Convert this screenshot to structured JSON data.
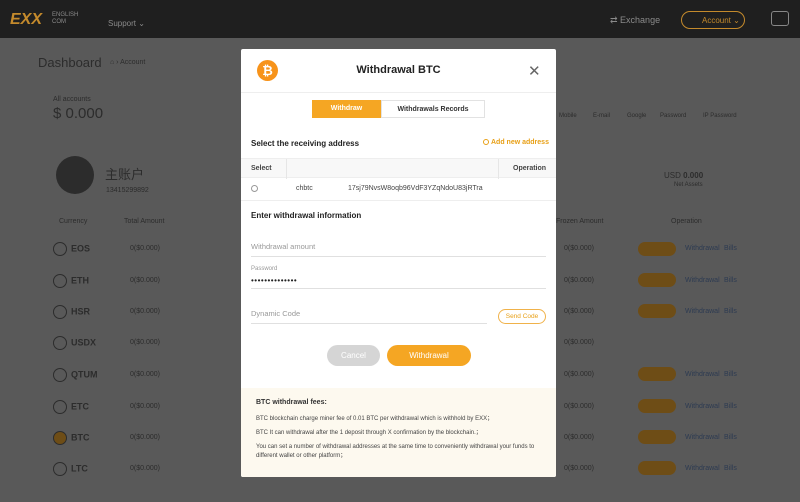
{
  "topbar": {
    "logo": "EXX",
    "logo_sub_1": "ENGLISH",
    "logo_sub_2": "COM",
    "support": "Support",
    "exchange": "Exchange",
    "account": "Account"
  },
  "background": {
    "page_title": "Dashboard",
    "breadcrumb": "Account",
    "all_accounts_label": "All accounts",
    "total": "$ 0.000",
    "account_name": "主账户",
    "account_id": "13415299892",
    "usd_label": "USD",
    "usd_value": "0.000",
    "net_assets": "Net Assets",
    "security_items": [
      "Mobile",
      "E-mail",
      "Google",
      "Password",
      "IP Password"
    ],
    "columns": [
      "Currency",
      "Total Amount",
      "Frozen Amount",
      "Operation"
    ],
    "coins": [
      "EOS",
      "ETH",
      "HSR",
      "USDX",
      "QTUM",
      "ETC",
      "BTC",
      "LTC"
    ],
    "zero_value": "0($0.000)",
    "withdrawal_link": "Withdrawal",
    "bills_link": "Bills"
  },
  "modal": {
    "title": "Withdrawal  BTC",
    "coin_symbol": "₿",
    "tabs": [
      {
        "label": "Withdraw",
        "active": true
      },
      {
        "label": "Withdrawals Records",
        "active": false
      }
    ],
    "receiving_title": "Select the receiving address",
    "add_address": "Add new address",
    "table_headers": [
      "Select",
      "Operation"
    ],
    "address_row": {
      "label": "chbtc",
      "address": "17sj79NvsW8oqb96VdF3YZqNdoU83jRTra"
    },
    "info_title": "Enter withdrawal information",
    "amount_placeholder": "Withdrawal amount",
    "password_label": "Password",
    "password_value": "••••••••••••••",
    "dynamic_code_placeholder": "Dynamic Code",
    "send_code": "Send Code",
    "cancel": "Cancel",
    "withdrawal": "Withdrawal",
    "fees_title": "BTC withdrawal fees:",
    "fees_lines": [
      "BTC blockchain charge miner fee of 0.01 BTC per withdrawal which is withhold by EXX；",
      "BTC It can withdrawal after the 1 deposit through X confirmation by the blockchain.；",
      "You can set a number of withdrawal addresses at the same time to conveniently withdrawal your funds to different wallet or other platform；"
    ]
  },
  "colors": {
    "accent": "#f5a623",
    "overlay": "#595959",
    "topbar": "#1f1f1f"
  }
}
